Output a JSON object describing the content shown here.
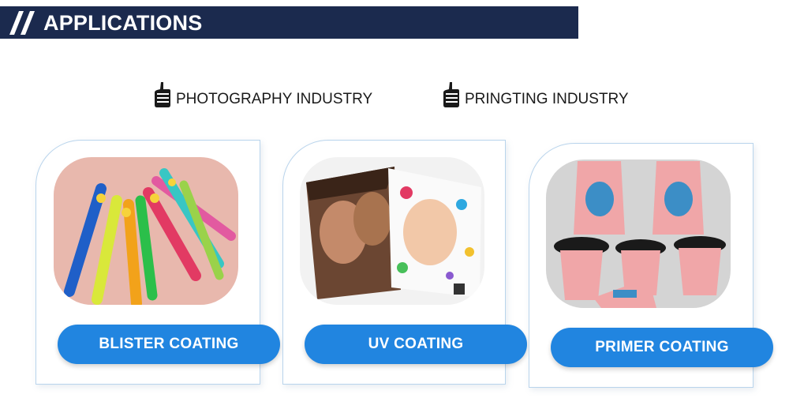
{
  "header": {
    "title": "APPLICATIONS"
  },
  "industries": [
    {
      "label": "PHOTOGRAPHY INDUSTRY",
      "icon": "thumbs-up-icon"
    },
    {
      "label": "PRINGTING INDUSTRY",
      "icon": "thumbs-up-icon"
    }
  ],
  "cards": [
    {
      "button_label": "BLISTER COATING",
      "image": "colorful-toothbrushes-photo"
    },
    {
      "button_label": "UV COATING",
      "image": "printed-photo-sheets"
    },
    {
      "button_label": "PRIMER COATING",
      "image": "printed-paper-cups-photo"
    }
  ],
  "colors": {
    "banner": "#1b2a4e",
    "button": "#2185e0",
    "card_border": "#b9d4ec"
  }
}
